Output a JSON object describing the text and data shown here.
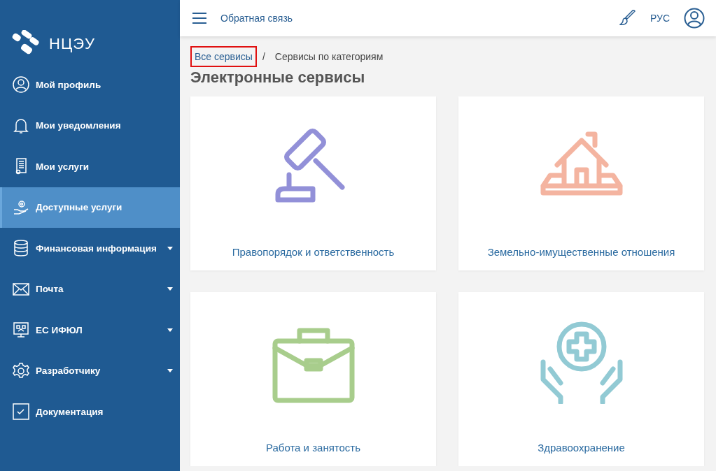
{
  "logo": {
    "text": "НЦЭУ"
  },
  "sidebar": {
    "items": [
      {
        "label": "Мой профиль",
        "selected": false,
        "has_submenu": false
      },
      {
        "label": "Мои уведомления",
        "selected": false,
        "has_submenu": false
      },
      {
        "label": "Мои услуги",
        "selected": false,
        "has_submenu": false
      },
      {
        "label": "Доступные услуги",
        "selected": true,
        "has_submenu": false
      },
      {
        "label": "Финансовая информация",
        "selected": false,
        "has_submenu": true
      },
      {
        "label": "Почта",
        "selected": false,
        "has_submenu": true
      },
      {
        "label": "ЕС ИФЮЛ",
        "selected": false,
        "has_submenu": true
      },
      {
        "label": "Разработчику",
        "selected": false,
        "has_submenu": true
      },
      {
        "label": "Документация",
        "selected": false,
        "has_submenu": false
      }
    ]
  },
  "topbar": {
    "feedback": "Обратная связь",
    "language": "РУС"
  },
  "breadcrumbs": [
    {
      "label": "Все сервисы",
      "highlighted": true
    },
    {
      "label": "Сервисы по категориям",
      "highlighted": false
    }
  ],
  "breadcrumb_separator": "/",
  "title": "Электронные сервисы",
  "cards": [
    {
      "label": "Правопорядок и ответственность",
      "color": "#9290d8"
    },
    {
      "label": "Земельно-имущественные отношения",
      "color": "#f4b4a0"
    },
    {
      "label": "Работа и занятость",
      "color": "#a8cd8c"
    },
    {
      "label": "Здравоохранение",
      "color": "#92cad4"
    }
  ]
}
